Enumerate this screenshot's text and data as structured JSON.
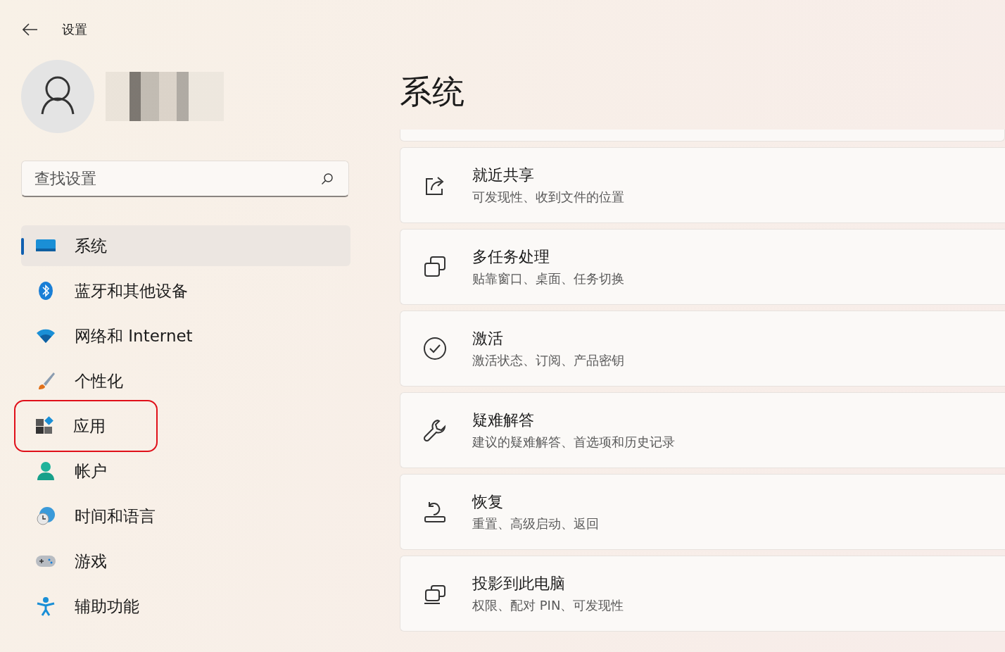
{
  "window": {
    "title": "设置"
  },
  "profile": {
    "name_redacted": true
  },
  "search": {
    "placeholder": "查找设置"
  },
  "nav": [
    {
      "label": "系统",
      "kind": "system",
      "selected": true,
      "highlighted": false
    },
    {
      "label": "蓝牙和其他设备",
      "kind": "bluetooth",
      "selected": false,
      "highlighted": false
    },
    {
      "label": "网络和 Internet",
      "kind": "wifi",
      "selected": false,
      "highlighted": false
    },
    {
      "label": "个性化",
      "kind": "brush",
      "selected": false,
      "highlighted": false
    },
    {
      "label": "应用",
      "kind": "apps",
      "selected": false,
      "highlighted": true
    },
    {
      "label": "帐户",
      "kind": "account",
      "selected": false,
      "highlighted": false
    },
    {
      "label": "时间和语言",
      "kind": "clock",
      "selected": false,
      "highlighted": false
    },
    {
      "label": "游戏",
      "kind": "gamepad",
      "selected": false,
      "highlighted": false
    },
    {
      "label": "辅助功能",
      "kind": "accessibility",
      "selected": false,
      "highlighted": false
    }
  ],
  "page": {
    "title": "系统",
    "cards": [
      {
        "kind": "share",
        "title": "就近共享",
        "subtitle": "可发现性、收到文件的位置"
      },
      {
        "kind": "multitask",
        "title": "多任务处理",
        "subtitle": "贴靠窗口、桌面、任务切换"
      },
      {
        "kind": "check",
        "title": "激活",
        "subtitle": "激活状态、订阅、产品密钥"
      },
      {
        "kind": "wrench",
        "title": "疑难解答",
        "subtitle": "建议的疑难解答、首选项和历史记录"
      },
      {
        "kind": "recovery",
        "title": "恢复",
        "subtitle": "重置、高级启动、返回"
      },
      {
        "kind": "project",
        "title": "投影到此电脑",
        "subtitle": "权限、配对 PIN、可发现性"
      }
    ]
  }
}
